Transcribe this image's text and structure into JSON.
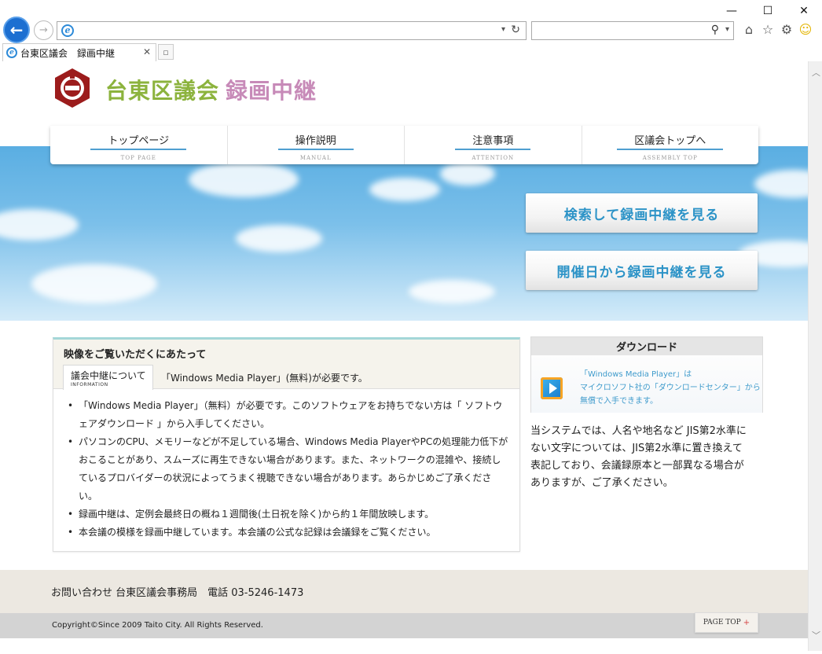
{
  "browser": {
    "tab_title": "台東区議会　録画中継",
    "address_value": "",
    "search_value": "",
    "window_controls": [
      "—",
      "☐",
      "✕"
    ],
    "icons": [
      "back-arrow-icon",
      "forward-arrow-icon",
      "ie-logo-icon",
      "refresh-icon",
      "search-icon",
      "home-icon",
      "favorites-star-icon",
      "settings-gear-icon",
      "smiley-feedback-icon"
    ]
  },
  "header": {
    "title_part1": "台東区議会",
    "title_part2": "録画中継",
    "colors": {
      "title_part1": "#8cb33d",
      "title_part2": "#c78ab8"
    }
  },
  "nav": [
    {
      "label": "トップページ",
      "sub": "TOP PAGE"
    },
    {
      "label": "操作説明",
      "sub": "MANUAL"
    },
    {
      "label": "注意事項",
      "sub": "ATTENTION"
    },
    {
      "label": "区議会トップへ",
      "sub": "ASSEMBLY TOP"
    }
  ],
  "cta": {
    "search": "検索して録画中継を見る",
    "by_date": "開催日から録画中継を見る",
    "color": "#2c93c7"
  },
  "notice": {
    "title": "映像をご覧いただくにあたって",
    "tab_label": "議会中継について",
    "tab_sub": "INFORMATION",
    "requirement": "「Windows Media Player」(無料)が必要です。",
    "items": [
      "「Windows Media Player」（無料）が必要です。このソフトウェアをお持ちでない方は「 ソフトウェアダウンロード 」から入手してください。",
      "パソコンのCPU、メモリーなどが不足している場合、Windows Media PlayerやPCの処理能力低下がおこることがあり、スムーズに再生できない場合があります。また、ネットワークの混雑や、接続しているプロバイダーの状況によってうまく視聴できない場合があります。あらかじめご了承ください。",
      "録画中継は、定例会最終日の概ね１週間後(土日祝を除く)から約１年間放映します。",
      "本会議の模様を録画中継しています。本会議の公式な記録は会議録をご覧ください。"
    ]
  },
  "download": {
    "heading": "ダウンロード",
    "line1": "「Windows Media Player」は",
    "line2": "マイクロソフト社の「ダウンロードセンター」から",
    "line3": "無償で入手できます。"
  },
  "side_note": "当システムでは、人名や地名など JIS第2水準にない文字については、JIS第2水準に置き換えて表記しており、会議録原本と一部異なる場合がありますが、ご了承ください。",
  "footer": {
    "contact": "お問い合わせ 台東区議会事務局　電話 03-5246-1473",
    "copyright": "Copyright©Since 2009 Taito City. All Rights Reserved.",
    "page_top": "PAGE TOP",
    "page_top_mark": "+"
  }
}
